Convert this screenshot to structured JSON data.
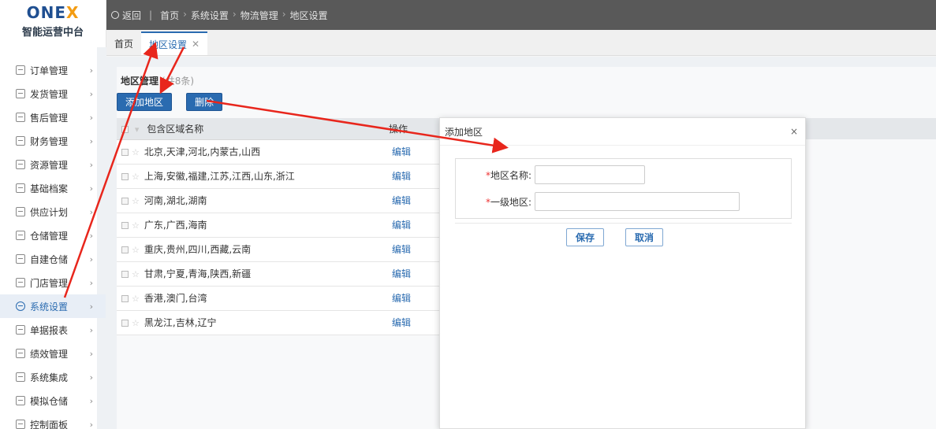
{
  "brand": {
    "logo": "ONEX",
    "subtitle": "智能运营中台"
  },
  "sidebar": {
    "items": [
      {
        "label": "订单管理",
        "icon": "order-icon",
        "active": false
      },
      {
        "label": "发货管理",
        "icon": "shipping-icon",
        "active": false
      },
      {
        "label": "售后管理",
        "icon": "after-sales-icon",
        "active": false
      },
      {
        "label": "财务管理",
        "icon": "finance-icon",
        "active": false
      },
      {
        "label": "资源管理",
        "icon": "resource-icon",
        "active": false
      },
      {
        "label": "基础档案",
        "icon": "archive-icon",
        "active": false
      },
      {
        "label": "供应计划",
        "icon": "supply-icon",
        "active": false
      },
      {
        "label": "仓储管理",
        "icon": "warehouse-icon",
        "active": false
      },
      {
        "label": "自建仓储",
        "icon": "self-warehouse-icon",
        "active": false
      },
      {
        "label": "门店管理",
        "icon": "store-icon",
        "active": false
      },
      {
        "label": "系统设置",
        "icon": "settings-icon",
        "active": true
      },
      {
        "label": "单据报表",
        "icon": "report-icon",
        "active": false
      },
      {
        "label": "绩效管理",
        "icon": "performance-icon",
        "active": false
      },
      {
        "label": "系统集成",
        "icon": "integration-icon",
        "active": false
      },
      {
        "label": "模拟仓储",
        "icon": "simulation-icon",
        "active": false
      },
      {
        "label": "控制面板",
        "icon": "dashboard-icon",
        "active": false
      }
    ]
  },
  "topbar": {
    "back_label": "返回",
    "breadcrumb": [
      "首页",
      "系统设置",
      "物流管理",
      "地区设置"
    ]
  },
  "tabs": [
    {
      "label": "首页",
      "active": false
    },
    {
      "label": "地区设置",
      "active": true
    }
  ],
  "panel": {
    "title": "地区管理",
    "count": "(共8条)",
    "add_button": "添加地区",
    "delete_button": "删除"
  },
  "table": {
    "headers": {
      "region": "包含区域名称",
      "op": "操作"
    },
    "rows": [
      {
        "region": "北京,天津,河北,内蒙古,山西",
        "op": "编辑"
      },
      {
        "region": "上海,安徽,福建,江苏,江西,山东,浙江",
        "op": "编辑"
      },
      {
        "region": "河南,湖北,湖南",
        "op": "编辑"
      },
      {
        "region": "广东,广西,海南",
        "op": "编辑"
      },
      {
        "region": "重庆,贵州,四川,西藏,云南",
        "op": "编辑"
      },
      {
        "region": "甘肃,宁夏,青海,陕西,新疆",
        "op": "编辑"
      },
      {
        "region": "香港,澳门,台湾",
        "op": "编辑"
      },
      {
        "region": "黑龙江,吉林,辽宁",
        "op": "编辑"
      }
    ]
  },
  "modal": {
    "title": "添加地区",
    "close": "×",
    "fields": {
      "name_label": "地区名称:",
      "name_value": "",
      "level_label": "一级地区:",
      "level_value": ""
    },
    "required_mark": "*",
    "save_button": "保存",
    "cancel_button": "取消"
  },
  "colors": {
    "accent": "#2a6bb0",
    "topbar": "#595959",
    "annotation_arrow": "#e8261c"
  }
}
